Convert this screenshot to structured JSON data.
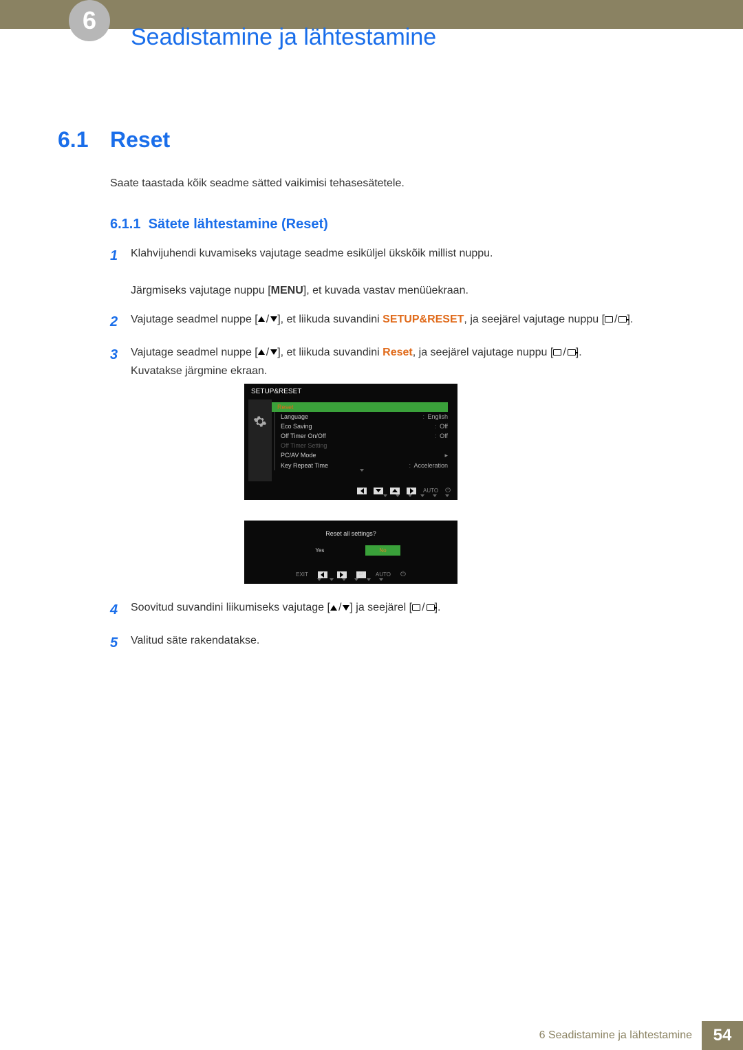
{
  "chapter": {
    "number": "6",
    "title": "Seadistamine ja lähtestamine"
  },
  "section": {
    "number": "6.1",
    "title": "Reset",
    "intro": "Saate taastada kõik seadme sätted vaikimisi tehasesätetele."
  },
  "subsection": {
    "number": "6.1.1",
    "title": "Sätete lähtestamine (Reset)"
  },
  "steps": {
    "s1_a": "Klahvijuhendi kuvamiseks vajutage seadme esiküljel ükskõik millist nuppu.",
    "s1_b_pre": "Järgmiseks vajutage nuppu [",
    "s1_b_menu": "MENU",
    "s1_b_post": "], et kuvada vastav menüüekraan.",
    "s2_pre": "Vajutage seadmel nuppe [",
    "s2_mid": "], et liikuda suvandini ",
    "s2_target": "SETUP&RESET",
    "s2_post": ", ja seejärel vajutage nuppu [",
    "s2_end": "].",
    "s3_pre": "Vajutage seadmel nuppe [",
    "s3_mid": "], et liikuda suvandini ",
    "s3_target": "Reset",
    "s3_post": ", ja seejärel vajutage nuppu [",
    "s3_end": "].",
    "s3_after": "Kuvatakse järgmine ekraan.",
    "s4_pre": "Soovitud suvandini liikumiseks vajutage [",
    "s4_mid": "] ja seejärel [",
    "s4_end": "].",
    "s5": "Valitud säte rakendatakse."
  },
  "osd1": {
    "title": "SETUP&RESET",
    "items": [
      {
        "label": "Reset",
        "value": "",
        "highlight": true
      },
      {
        "label": "Language",
        "value": "English"
      },
      {
        "label": "Eco Saving",
        "value": "Off"
      },
      {
        "label": "Off Timer On/Off",
        "value": "Off"
      },
      {
        "label": "Off Timer Setting",
        "value": "",
        "dim": true
      },
      {
        "label": "PC/AV Mode",
        "value": "",
        "arrow": true
      },
      {
        "label": "Key Repeat Time",
        "value": "Acceleration"
      }
    ],
    "nav_auto": "AUTO"
  },
  "osd2": {
    "question": "Reset all settings?",
    "yes": "Yes",
    "no": "No",
    "exit": "EXIT",
    "auto": "AUTO"
  },
  "footer": {
    "text": "6 Seadistamine ja lähtestamine",
    "page": "54"
  }
}
